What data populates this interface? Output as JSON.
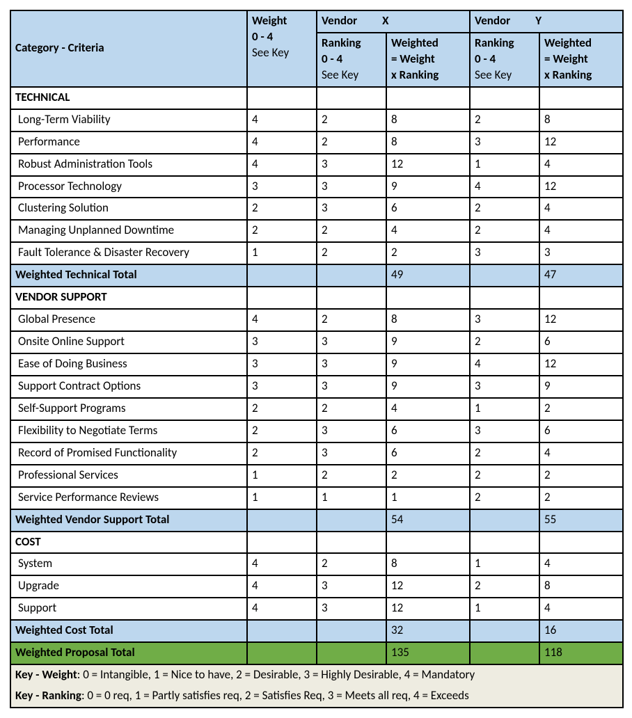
{
  "headers": {
    "criteria": "Category - Criteria",
    "weight_l1": "Weight",
    "weight_l2": "0 - 4",
    "weight_l3": "See Key",
    "vendor_x": "Vendor",
    "vendor_x_letter": "X",
    "vendor_y": "Vendor",
    "vendor_y_letter": "Y",
    "ranking_l1": "Ranking",
    "ranking_l2": "0 - 4",
    "ranking_l3": "See Key",
    "weighted_l1": "Weighted",
    "weighted_l2": "= Weight",
    "weighted_l3": "x Ranking"
  },
  "sections": {
    "technical": {
      "title": "TECHNICAL",
      "rows": [
        {
          "criteria": "Long-Term Viability",
          "weight": "4",
          "rx": "2",
          "wx": "8",
          "ry": "2",
          "wy": "8"
        },
        {
          "criteria": "Performance",
          "weight": "4",
          "rx": "2",
          "wx": "8",
          "ry": "3",
          "wy": "12"
        },
        {
          "criteria": "Robust Administration Tools",
          "weight": "4",
          "rx": "3",
          "wx": "12",
          "ry": "1",
          "wy": "4"
        },
        {
          "criteria": "Processor Technology",
          "weight": "3",
          "rx": "3",
          "wx": "9",
          "ry": "4",
          "wy": "12"
        },
        {
          "criteria": "Clustering Solution",
          "weight": "2",
          "rx": "3",
          "wx": "6",
          "ry": "2",
          "wy": "4"
        },
        {
          "criteria": "Managing Unplanned Downtime",
          "weight": "2",
          "rx": "2",
          "wx": "4",
          "ry": "2",
          "wy": "4"
        },
        {
          "criteria": "Fault Tolerance & Disaster Recovery",
          "weight": "1",
          "rx": "2",
          "wx": "2",
          "ry": "3",
          "wy": "3"
        }
      ],
      "total_label": "Weighted Technical Total",
      "total_x": "49",
      "total_y": "47"
    },
    "vendor_support": {
      "title": "VENDOR SUPPORT",
      "rows": [
        {
          "criteria": "Global Presence",
          "weight": "4",
          "rx": "2",
          "wx": "8",
          "ry": "3",
          "wy": "12"
        },
        {
          "criteria": "Onsite Online Support",
          "weight": "3",
          "rx": "3",
          "wx": "9",
          "ry": "2",
          "wy": "6"
        },
        {
          "criteria": "Ease of Doing Business",
          "weight": "3",
          "rx": "3",
          "wx": "9",
          "ry": "4",
          "wy": "12"
        },
        {
          "criteria": "Support Contract Options",
          "weight": "3",
          "rx": "3",
          "wx": "9",
          "ry": "3",
          "wy": "9"
        },
        {
          "criteria": "Self-Support Programs",
          "weight": "2",
          "rx": "2",
          "wx": "4",
          "ry": "1",
          "wy": "2"
        },
        {
          "criteria": "Flexibility to Negotiate Terms",
          "weight": "2",
          "rx": "3",
          "wx": "6",
          "ry": "3",
          "wy": "6"
        },
        {
          "criteria": "Record of Promised Functionality",
          "weight": "2",
          "rx": "3",
          "wx": "6",
          "ry": "2",
          "wy": "4"
        },
        {
          "criteria": "Professional Services",
          "weight": "1",
          "rx": "2",
          "wx": "2",
          "ry": "2",
          "wy": "2"
        },
        {
          "criteria": "Service Performance Reviews",
          "weight": "1",
          "rx": "1",
          "wx": "1",
          "ry": "2",
          "wy": "2"
        }
      ],
      "total_label": "Weighted Vendor Support Total",
      "total_x": "54",
      "total_y": "55"
    },
    "cost": {
      "title": "COST",
      "rows": [
        {
          "criteria": "System",
          "weight": "4",
          "rx": "2",
          "wx": "8",
          "ry": "1",
          "wy": "4"
        },
        {
          "criteria": "Upgrade",
          "weight": "4",
          "rx": "3",
          "wx": "12",
          "ry": "2",
          "wy": "8"
        },
        {
          "criteria": "Support",
          "weight": "4",
          "rx": "3",
          "wx": "12",
          "ry": "1",
          "wy": "4"
        }
      ],
      "total_label": "Weighted Cost Total",
      "total_x": "32",
      "total_y": "16"
    }
  },
  "proposal_total": {
    "label": "Weighted Proposal Total",
    "x": "135",
    "y": "118"
  },
  "key": {
    "weight_label": "Key - Weight",
    "weight_text": ": 0 = Intangible, 1 = Nice to have, 2 = Desirable, 3 = Highly Desirable, 4 = Mandatory",
    "ranking_label": "Key - Ranking",
    "ranking_text": ": 0 = 0 req, 1 = Partly satisfies req, 2 = Satisfies Req, 3 = Meets all req, 4 = Exceeds"
  }
}
